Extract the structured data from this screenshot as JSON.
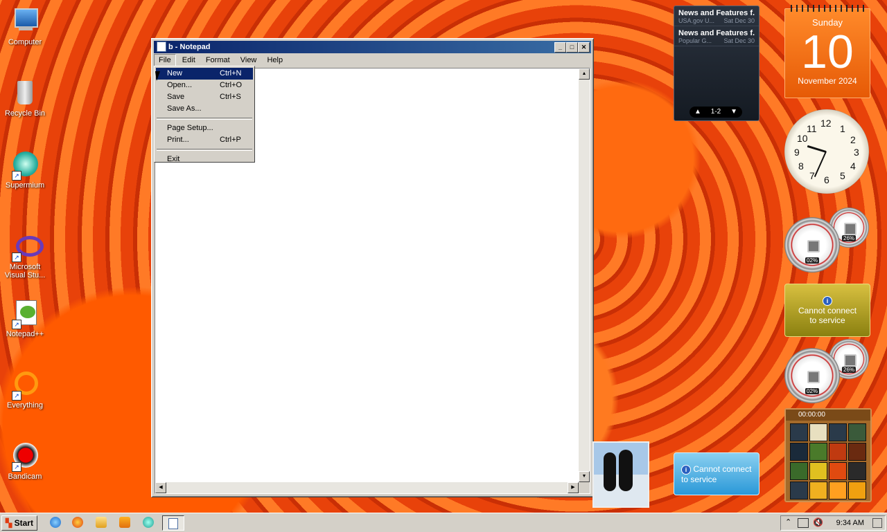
{
  "desktop": {
    "icons": [
      {
        "label": "Computer"
      },
      {
        "label": "Recycle Bin"
      },
      {
        "label": "Supermium"
      },
      {
        "label": "Microsoft Visual Stu..."
      },
      {
        "label": "Notepad++"
      },
      {
        "label": "Everything"
      },
      {
        "label": "Bandicam"
      }
    ]
  },
  "notepad": {
    "title": "b - Notepad",
    "menus": [
      "File",
      "Edit",
      "Format",
      "View",
      "Help"
    ],
    "open_menu": "File",
    "file_menu": [
      {
        "label": "New",
        "shortcut": "Ctrl+N"
      },
      {
        "label": "Open...",
        "shortcut": "Ctrl+O"
      },
      {
        "label": "Save",
        "shortcut": "Ctrl+S"
      },
      {
        "label": "Save As...",
        "shortcut": ""
      },
      {
        "label": "Page Setup...",
        "shortcut": ""
      },
      {
        "label": "Print...",
        "shortcut": "Ctrl+P"
      },
      {
        "label": "Exit",
        "shortcut": ""
      }
    ],
    "highlighted_item": "New"
  },
  "gadgets": {
    "rss": {
      "items": [
        {
          "title": "News and Features f...",
          "source": "USA.gov U...",
          "date": "Sat Dec 30"
        },
        {
          "title": "News and Features f...",
          "source": "Popular G...",
          "date": "Sat Dec 30"
        }
      ],
      "pager": "1-2"
    },
    "calendar": {
      "weekday": "Sunday",
      "day": "10",
      "month_year": "November 2024"
    },
    "clock_numbers": [
      "12",
      "1",
      "2",
      "3",
      "4",
      "5",
      "6",
      "7",
      "8",
      "9",
      "10",
      "11"
    ],
    "meters": [
      {
        "cpu": "02%",
        "mem": "26%"
      },
      {
        "cpu": "02%",
        "mem": "26%"
      }
    ],
    "weather_message": "Cannot connect to service",
    "weather_message_2": "Cannot connect to service",
    "puzzle_timer": "00:00:00"
  },
  "taskbar": {
    "start_label": "Start",
    "clock": "9:34 AM"
  },
  "colors": {
    "titlebar": "#0a246a",
    "menu_highlight": "#0a246a",
    "calendar": "#f07020"
  }
}
